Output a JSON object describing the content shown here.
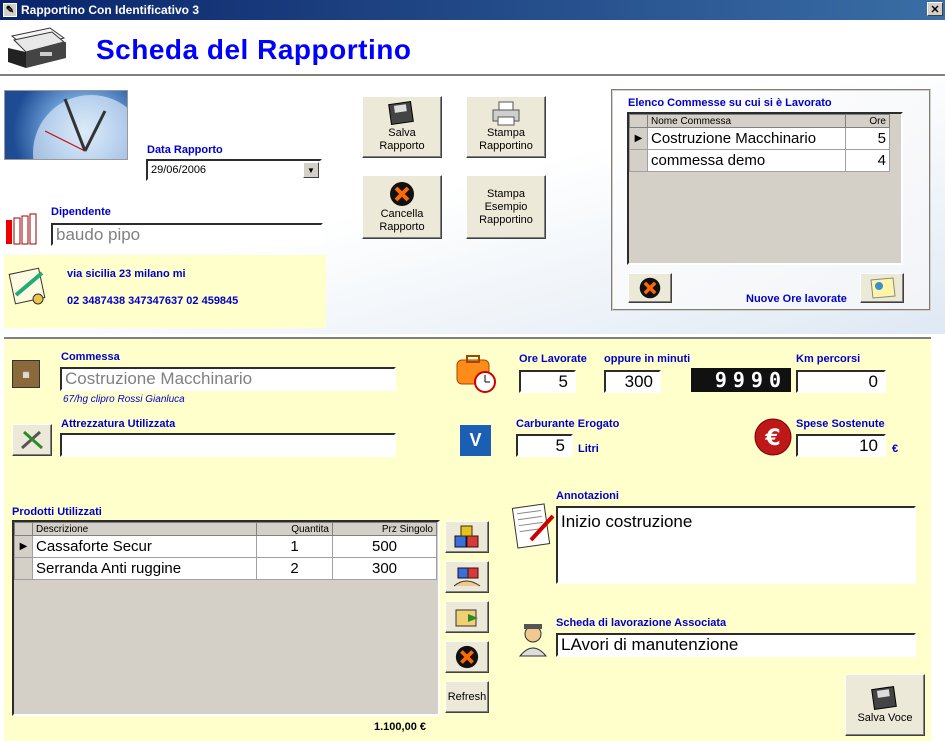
{
  "window": {
    "title": "Rapportino Con Identificativo 3",
    "close": "✕"
  },
  "header": {
    "title": "Scheda del Rapportino"
  },
  "data_rapporto": {
    "label": "Data Rapporto",
    "value": "29/06/2006"
  },
  "dipendente": {
    "label": "Dipendente",
    "value": "baudo pipo"
  },
  "address": {
    "line1": "via sicilia 23 milano mi",
    "phones": "02 3487438 347347637 02 459845"
  },
  "buttons": {
    "salva_rapporto": [
      "Salva",
      "Rapporto"
    ],
    "stampa_rapportino": [
      "Stampa",
      "Rapportino"
    ],
    "cancella_rapporto": [
      "Cancella",
      "Rapporto"
    ],
    "stampa_esempio": [
      "Stampa",
      "Esempio",
      "Rapportino"
    ],
    "refresh": "Refresh",
    "salva_voce": "Salva Voce"
  },
  "commesse": {
    "title": "Elenco Commesse su cui si è Lavorato",
    "columns": [
      "Nome Commessa",
      "Ore"
    ],
    "rows": [
      {
        "nome": "Costruzione Macchinario",
        "ore": "5",
        "selected": true
      },
      {
        "nome": "commessa demo",
        "ore": "4",
        "selected": false
      }
    ],
    "nuove_ore_label": "Nuove Ore lavorate"
  },
  "form": {
    "commessa": {
      "label": "Commessa",
      "value": "Costruzione Macchinario",
      "sub": "67/hg clipro Rossi Gianluca"
    },
    "attrezzatura": {
      "label": "Attrezzatura Utilizzata",
      "value": ""
    },
    "ore_lavorate": {
      "label": "Ore Lavorate",
      "value": "5"
    },
    "minuti": {
      "label": "oppure in minuti",
      "value": "300"
    },
    "odometer": "9990",
    "km": {
      "label": "Km percorsi",
      "value": "0"
    },
    "carburante": {
      "label": "Carburante Erogato",
      "value": "5",
      "unit": "Litri"
    },
    "spese": {
      "label": "Spese Sostenute",
      "value": "10",
      "unit": "€"
    },
    "annotazioni": {
      "label": "Annotazioni",
      "value": "Inizio costruzione"
    },
    "scheda": {
      "label": "Scheda di lavorazione Associata",
      "value": "LAvori di manutenzione"
    }
  },
  "prodotti": {
    "title": "Prodotti Utilizzati",
    "columns": [
      "Descrizione",
      "Quantita",
      "Prz Singolo"
    ],
    "rows": [
      {
        "descrizione": "Cassaforte Secur",
        "quantita": "1",
        "prezzo": "500",
        "selected": true
      },
      {
        "descrizione": "Serranda Anti ruggine",
        "quantita": "2",
        "prezzo": "300",
        "selected": false
      }
    ],
    "total": "1.100,00 €"
  },
  "colors": {
    "title_blue": "#0000ff",
    "label_blue": "#0000cc",
    "form_bg": "#ffffcc"
  }
}
